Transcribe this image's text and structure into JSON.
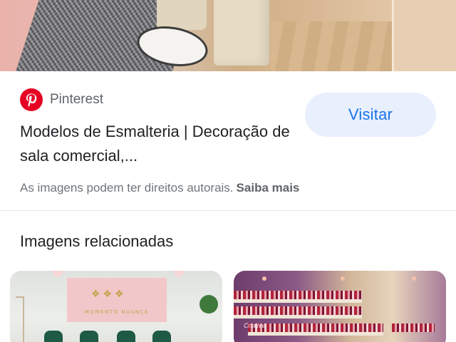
{
  "result": {
    "source_name": "Pinterest",
    "source_icon": "pinterest-icon",
    "title": "Modelos de Esmalteria | Decoração de sala comercial,...",
    "visit_label": "Visitar",
    "copyright_notice": "As imagens podem ter direitos autorais.",
    "learn_more_label": "Saiba mais"
  },
  "related": {
    "heading": "Imagens relacionadas",
    "thumb1_brand": "MOMENTO NUANCE",
    "thumb2_text": "Criative"
  },
  "colors": {
    "accent": "#1a73e8",
    "button_bg": "#e8f0fe",
    "pinterest_red": "#e60023",
    "secondary_text": "#70757a"
  }
}
